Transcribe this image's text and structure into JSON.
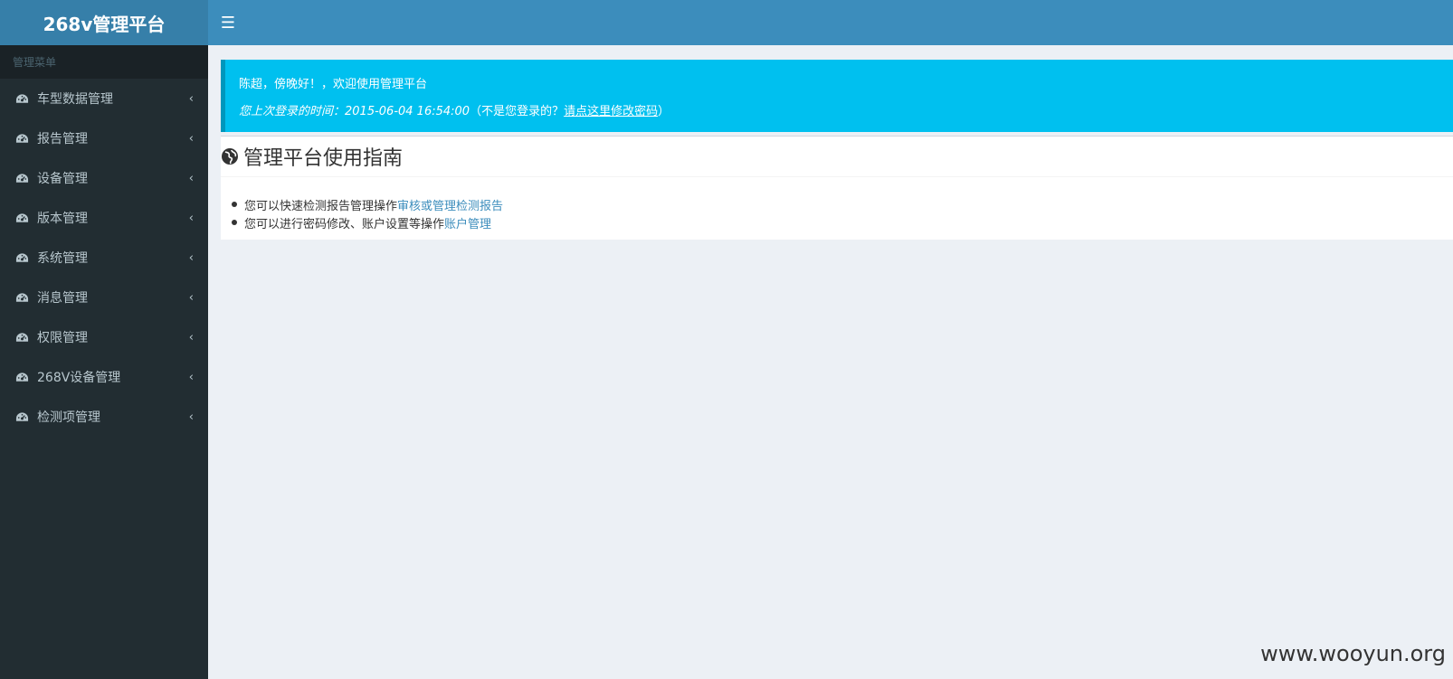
{
  "header": {
    "logo_text": "268v管理平台",
    "toggle_icon": "hamburger-menu-icon"
  },
  "sidebar": {
    "section_title": "管理菜单",
    "items": [
      {
        "label": "车型数据管理"
      },
      {
        "label": "报告管理"
      },
      {
        "label": "设备管理"
      },
      {
        "label": "版本管理"
      },
      {
        "label": "系统管理"
      },
      {
        "label": "消息管理"
      },
      {
        "label": "权限管理"
      },
      {
        "label": "268V设备管理"
      },
      {
        "label": "检测项管理"
      }
    ]
  },
  "welcome": {
    "greeting": "陈超，傍晚好！，欢迎使用管理平台",
    "last_login_prefix": "您上次登录的时间：2015-06-04 16:54:00",
    "not_you": "（不是您登录的？",
    "change_password_link": "请点这里修改密码",
    "close_paren": "）"
  },
  "guide": {
    "title": "管理平台使用指南",
    "items": [
      {
        "text": "您可以快速检测报告管理操作",
        "link": "审核或管理检测报告"
      },
      {
        "text": "您可以进行密码修改、账户设置等操作",
        "link": "账户管理"
      }
    ]
  },
  "watermark": "www.wooyun.org",
  "colors": {
    "header": "#3c8dbc",
    "logo_bg": "#367fa9",
    "sidebar": "#222d32",
    "callout": "#00c0ef",
    "link": "#3c8dbc"
  }
}
